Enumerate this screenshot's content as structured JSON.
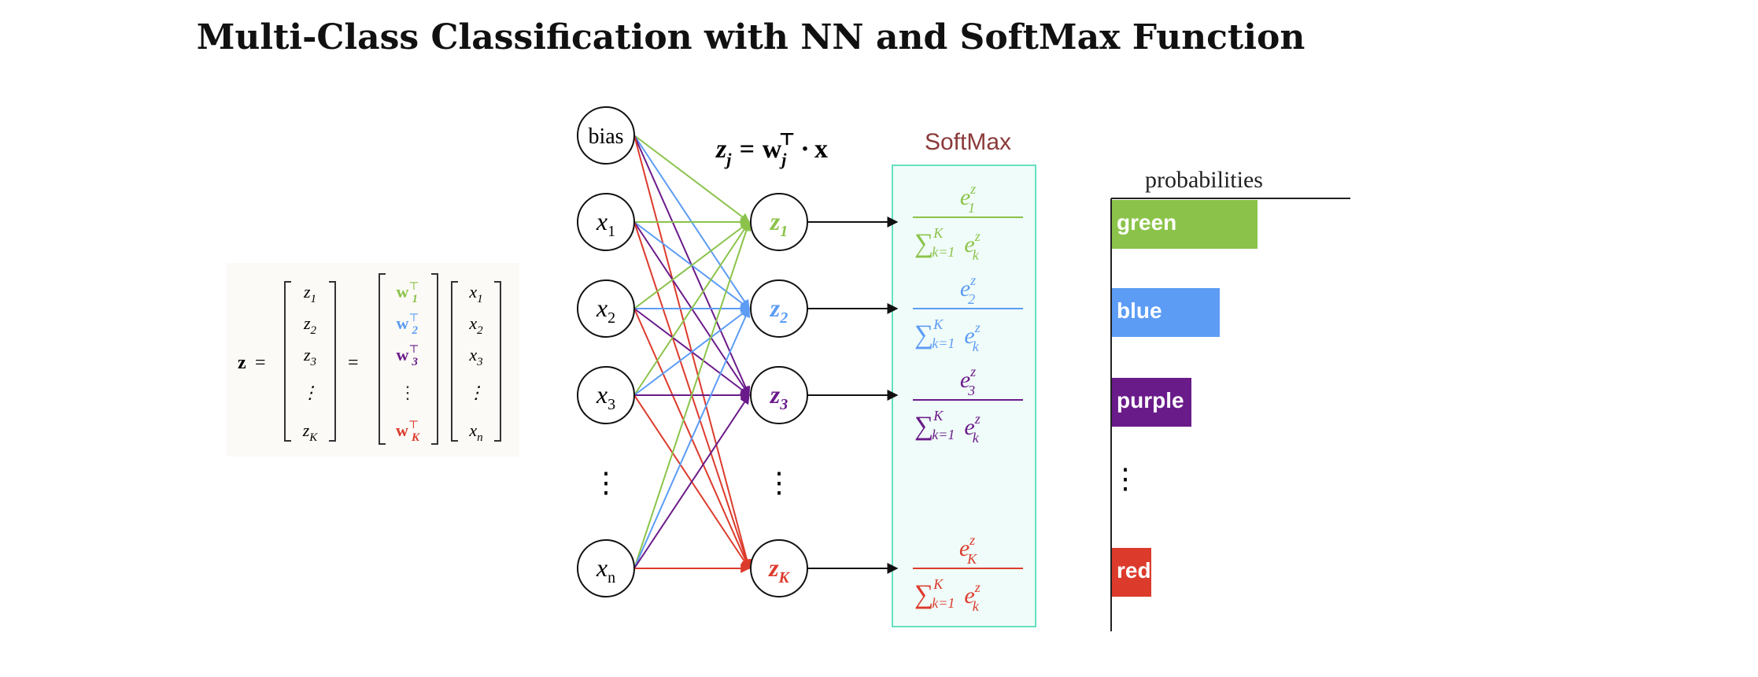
{
  "title": "Multi-Class Classification with NN and SoftMax Function",
  "colors": {
    "green": "#8bc34a",
    "blue": "#5c9cf5",
    "purple": "#6a1b8a",
    "red": "#dc3b2c",
    "softmax_title": "#8b3a3a",
    "softmax_border": "#66e0c2",
    "softmax_fill": "#f0fcf9"
  },
  "matrix": {
    "lhs": "z",
    "equals": "=",
    "z_column": [
      "z",
      "z",
      "z",
      "⋮",
      "z"
    ],
    "z_subscripts": [
      "1",
      "2",
      "3",
      "",
      "K"
    ],
    "w_column": [
      "w",
      "w",
      "w",
      "⋮",
      "w"
    ],
    "w_subscripts": [
      "1",
      "2",
      "3",
      "",
      "K"
    ],
    "transpose": "⊤",
    "x_column": [
      "x",
      "x",
      "x",
      "⋮",
      "x"
    ],
    "x_subscripts": [
      "1",
      "2",
      "3",
      "",
      "n"
    ]
  },
  "inputs": [
    {
      "label": "bias",
      "sub": ""
    },
    {
      "label": "x",
      "sub": "1"
    },
    {
      "label": "x",
      "sub": "2"
    },
    {
      "label": "x",
      "sub": "3"
    },
    {
      "label": "x",
      "sub": "n"
    }
  ],
  "outputs": [
    {
      "label": "z",
      "sub": "1"
    },
    {
      "label": "z",
      "sub": "2"
    },
    {
      "label": "z",
      "sub": "3"
    },
    {
      "label": "z",
      "sub": "K"
    }
  ],
  "vdots": "⋮",
  "formula": {
    "lhs": "z",
    "lhs_sub": "j",
    "eq": "=",
    "w": "w",
    "w_sub": "j",
    "transpose": "⊤",
    "dot": "·",
    "x": "x"
  },
  "softmax": {
    "title": "SoftMax",
    "numerator_base": "e",
    "numerator_sup": "z",
    "numerator_subs": [
      "1",
      "2",
      "3",
      "K"
    ],
    "sum": "∑",
    "sum_upper": "K",
    "sum_lower": "k=1",
    "den_base": "e",
    "den_sup": "z",
    "den_sub": "k"
  },
  "probabilities": {
    "title": "probabilities",
    "bars": [
      {
        "label": "green",
        "value": 0.77
      },
      {
        "label": "blue",
        "value": 0.57
      },
      {
        "label": "purple",
        "value": 0.42
      },
      {
        "label": "red",
        "value": 0.21
      }
    ]
  }
}
